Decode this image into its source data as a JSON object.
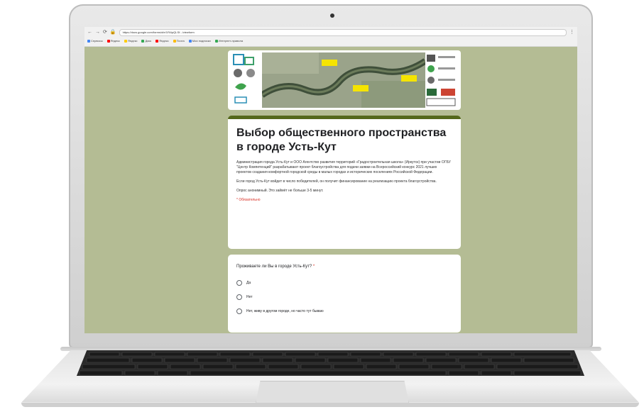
{
  "browser": {
    "url": "https://docs.google.com/forms/d/e/1FAIpQLSf.../viewform",
    "bookmarks": [
      {
        "label": "Сервисы",
        "color": "#4285f4"
      },
      {
        "label": "Яндекс",
        "color": "#ff0000"
      },
      {
        "label": "Яндекс",
        "color": "#ffcc00"
      },
      {
        "label": "Диск",
        "color": "#34a853"
      },
      {
        "label": "Яндекс",
        "color": "#ff0000"
      },
      {
        "label": "Почта",
        "color": "#fbbc05"
      },
      {
        "label": "Мои подписки",
        "color": "#4285f4"
      },
      {
        "label": "Интернет-правила",
        "color": "#34a853"
      }
    ]
  },
  "form": {
    "title": "Выбор общественного пространства в городе Усть-Кут",
    "description": [
      "Администрация города Усть-Кут и ООО Агентство развития территорий «Градостроительная школа» (Иркутск) при участии ОГБУ \"Центр Компетенций\" разрабатывают проект благоустройства для подачи заявки на Всероссийский конкурс 2021 лучших проектов создания комфортной городской среды в малых городах и исторических поселениях Российской Федерации.",
      "Если город Усть-Кут войдет в число победителей, он получит финансирование на реализацию проекта благоустройства.",
      "Опрос анонимный. Это займёт не больше 3-5 минут."
    ],
    "required_note": "* Обязательно",
    "question": "Проживаете ли Вы в городе Усть-Кут?",
    "required_star": "*",
    "options": [
      "Да",
      "Нет",
      "Нет, живу в другом городе, но часто тут бываю"
    ]
  },
  "colors": {
    "screen_bg": "#b4bc94",
    "header_accent": "#54681b"
  }
}
